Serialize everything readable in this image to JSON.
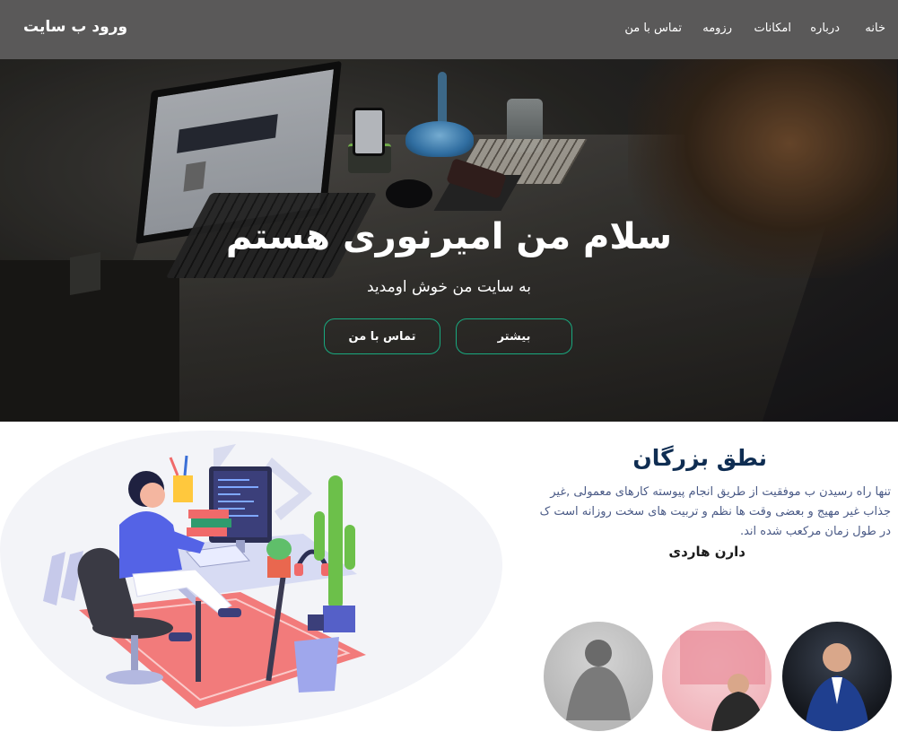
{
  "nav": {
    "brand": "ورود ب سایت",
    "items": [
      {
        "label": "خانه"
      },
      {
        "label": "درباره"
      },
      {
        "label": "امکانات"
      },
      {
        "label": "رزومه"
      },
      {
        "label": "تماس با من"
      }
    ]
  },
  "hero": {
    "title": "سلام من امیرنوری هستم",
    "subtitle": "به سایت من خوش اومدید",
    "more_button": "بیشتر",
    "contact_button": "تماس با من",
    "accent": "#19a97f"
  },
  "quote": {
    "title": "نطق بزرگان",
    "text": "تنها راه رسیدن ب موفقیت از طریق انجام پیوسته کارهای معمولی ,غیر جذاب غیر مهیج و بعضی وقت ها نظم و تربیت های سخت روزانه است ک در طول زمان مرکعب شده اند.",
    "author": "دارن هاردی",
    "title_color": "#0f2d52",
    "text_color": "#4a5a86"
  }
}
